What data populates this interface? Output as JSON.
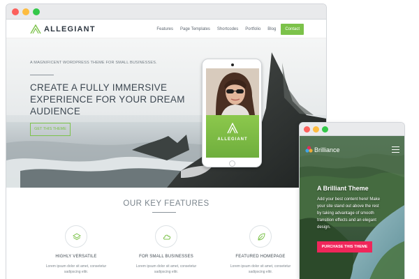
{
  "colors": {
    "accent_green": "#7cc24a",
    "mobile_cta": "#f0265a",
    "chrome": "#e9eaec"
  },
  "desktop": {
    "window_controls": [
      "close-dot",
      "minimize-dot",
      "maximize-dot"
    ],
    "site": {
      "logo_text": "ALLEGIANT",
      "nav": {
        "items": [
          "Features",
          "Page Templates",
          "Shortcodes",
          "Portfolio",
          "Blog"
        ],
        "cta": "Contact"
      },
      "hero": {
        "tagline": "A MAGNIFICENT WORDPRESS THEME FOR SMALL BUSINESSES.",
        "title_lines": [
          "CREATE A FULLY IMMERSIVE",
          "EXPERIENCE FOR YOUR DREAM",
          "AUDIENCE"
        ],
        "cta": "GET THIS THEME",
        "tablet_brand": "ALLEGIANT"
      },
      "features": {
        "heading": "OUR KEY FEATURES",
        "items": [
          {
            "icon": "layers-icon",
            "title": "HIGHLY VERSATILE",
            "text_lines": [
              "Lorem ipsum dolor sit amet, consetetur",
              "sadipscing elitr."
            ]
          },
          {
            "icon": "cloud-icon",
            "title": "FOR SMALL BUSINESSES",
            "text_lines": [
              "Lorem ipsum dolor sit amet, consetetur",
              "sadipscing elitr."
            ]
          },
          {
            "icon": "leaf-icon",
            "title": "FEATURED HOMEPAGE",
            "text_lines": [
              "Lorem ipsum dolor sit amet, consetetur",
              "sadipscing elitr."
            ]
          }
        ]
      }
    }
  },
  "mobile": {
    "brand": "Brilliance",
    "menu_icon": "hamburger-icon",
    "heading": "A Brilliant Theme",
    "text_lines": [
      "Add your best content here! Make",
      "your site stand out above the rest",
      "by taking advantage of smooth",
      "transition effects and an elegant",
      "design."
    ],
    "cta": "PURCHASE THIS THEME"
  }
}
